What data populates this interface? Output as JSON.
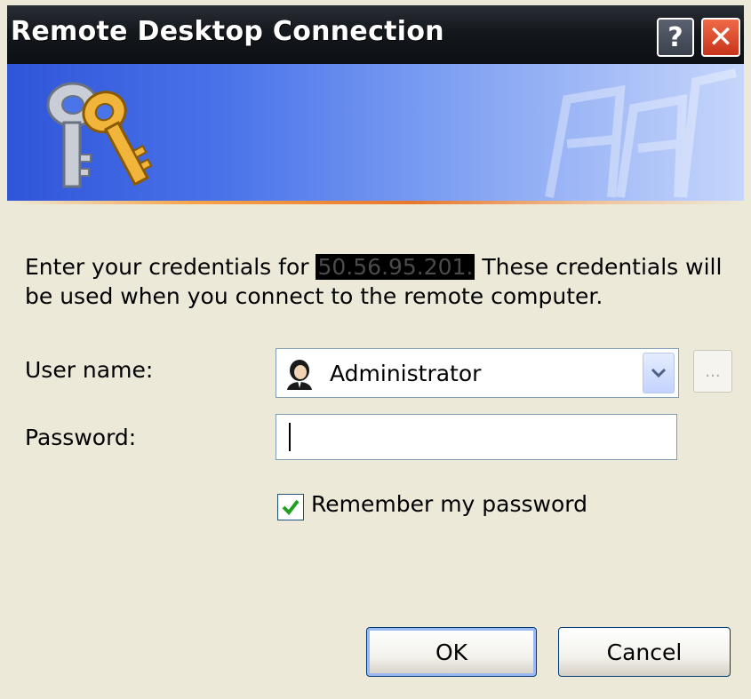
{
  "window": {
    "title": "Remote Desktop Connection",
    "help_label": "?",
    "close_label": "✕"
  },
  "prompt": {
    "text_before": "Enter your credentials for ",
    "host": "50.56.95.201.",
    "text_after": " These credentials will be used when you connect to the remote computer."
  },
  "form": {
    "username_label": "User name:",
    "username_value": "Administrator",
    "browse_label": "...",
    "password_label": "Password:",
    "password_value": "",
    "remember_label": "Remember my password",
    "remember_checked": true
  },
  "buttons": {
    "ok": "OK",
    "cancel": "Cancel"
  },
  "colors": {
    "titlebar": "#14181d",
    "banner_start": "#2f55d8",
    "banner_end": "#c6d6fb",
    "accent_line": "#e8772c",
    "checkmark": "#21a121"
  }
}
